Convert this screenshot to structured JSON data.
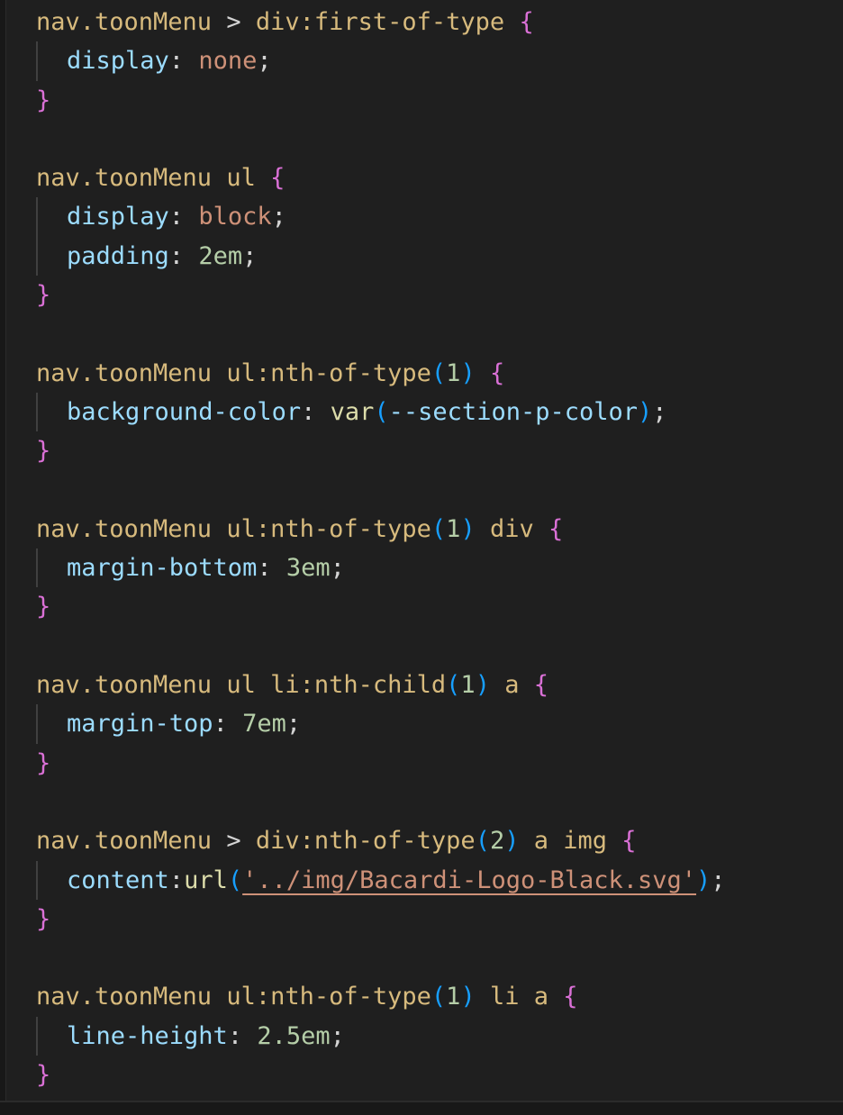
{
  "rules": [
    {
      "selector": "nav.toonMenu > div:first-of-type",
      "declarations": [
        {
          "property": "display",
          "value": "none"
        }
      ]
    },
    {
      "selector": "nav.toonMenu ul",
      "declarations": [
        {
          "property": "display",
          "value": "block"
        },
        {
          "property": "padding",
          "value": "2em"
        }
      ]
    },
    {
      "selector": "nav.toonMenu ul:nth-of-type(1)",
      "declarations": [
        {
          "property": "background-color",
          "value": "var(--section-p-color)"
        }
      ]
    },
    {
      "selector": "nav.toonMenu ul:nth-of-type(1) div",
      "declarations": [
        {
          "property": "margin-bottom",
          "value": "3em"
        }
      ]
    },
    {
      "selector": "nav.toonMenu ul li:nth-child(1) a",
      "declarations": [
        {
          "property": "margin-top",
          "value": "7em"
        }
      ]
    },
    {
      "selector": "nav.toonMenu > div:nth-of-type(2) a img",
      "declarations": [
        {
          "property": "content",
          "value": "url('../img/Bacardi-Logo-Black.svg')"
        }
      ]
    },
    {
      "selector": "nav.toonMenu ul:nth-of-type(1) li a",
      "declarations": [
        {
          "property": "line-height",
          "value": "2.5em"
        }
      ]
    }
  ],
  "theme": {
    "background": "#1f1f1f",
    "selector": "#d7ba7d",
    "brace": "#da70d6",
    "paren": "#179fff",
    "property": "#9cdcfe",
    "keyword_value": "#ce9178",
    "number": "#b5cea8",
    "function": "#dcdcaa",
    "string": "#ce9178"
  }
}
